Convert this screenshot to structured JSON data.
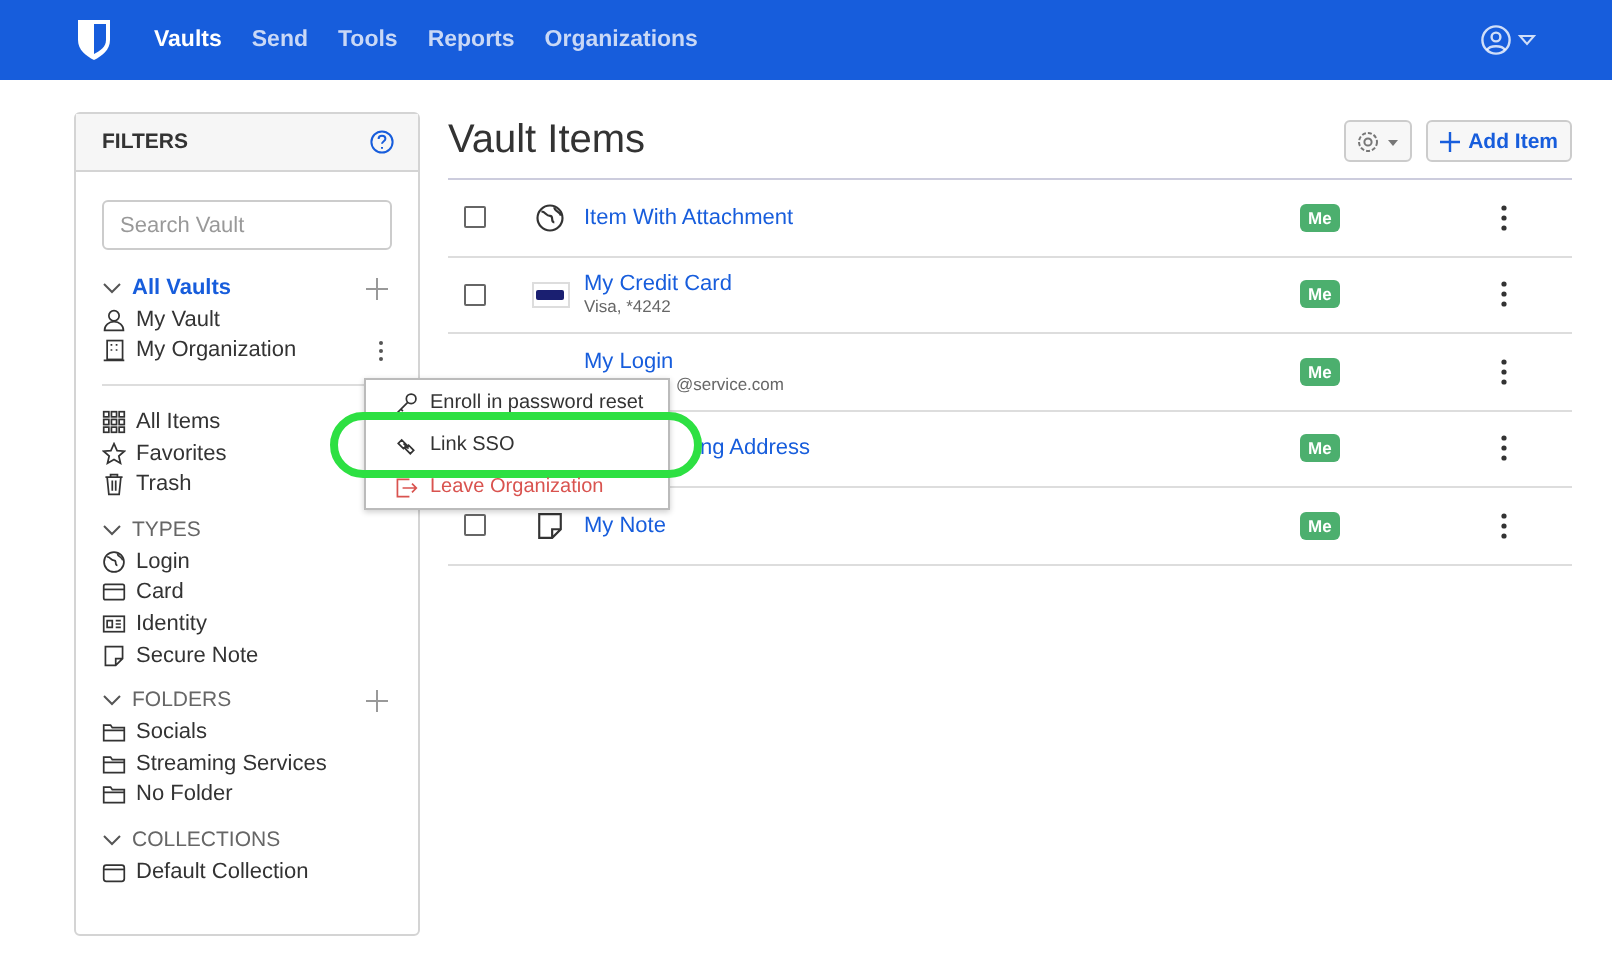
{
  "nav": {
    "links": [
      {
        "label": "Vaults",
        "selected": true
      },
      {
        "label": "Send",
        "selected": false
      },
      {
        "label": "Tools",
        "selected": false
      },
      {
        "label": "Reports",
        "selected": false
      },
      {
        "label": "Organizations",
        "selected": false
      }
    ]
  },
  "filters": {
    "title": "FILTERS",
    "search": {
      "placeholder": "Search Vault"
    },
    "sections": [
      {
        "kind": "vaults",
        "heading": "All Vaults",
        "selected": true,
        "expanded": true,
        "add": true,
        "items": [
          {
            "label": "My Vault",
            "kind": "person"
          },
          {
            "label": "My Organization",
            "kind": "org",
            "options": true
          }
        ]
      },
      {
        "divider": true,
        "items": [
          {
            "label": "All Items",
            "kind": "grid"
          },
          {
            "label": "Favorites",
            "kind": "star"
          },
          {
            "label": "Trash",
            "kind": "trash"
          }
        ]
      },
      {
        "kind": "group",
        "heading": "TYPES",
        "expanded": true,
        "items": [
          {
            "label": "Login",
            "kind": "globe"
          },
          {
            "label": "Card",
            "kind": "card"
          },
          {
            "label": "Identity",
            "kind": "id"
          },
          {
            "label": "Secure Note",
            "kind": "note"
          }
        ]
      },
      {
        "kind": "group",
        "heading": "FOLDERS",
        "expanded": true,
        "add": true,
        "items": [
          {
            "label": "Socials",
            "kind": "folder"
          },
          {
            "label": "Streaming Services",
            "kind": "folder"
          },
          {
            "label": "No Folder",
            "kind": "folder"
          }
        ]
      },
      {
        "kind": "group",
        "heading": "COLLECTIONS",
        "expanded": true,
        "items": [
          {
            "label": "Default Collection",
            "kind": "collection"
          }
        ]
      }
    ]
  },
  "main": {
    "title": "Vault Items",
    "add_button": "Add Item",
    "rows": [
      {
        "name": "Item With Attachment",
        "kind": "globe",
        "owner": "Me",
        "checked": false
      },
      {
        "name": "My Credit Card",
        "subtitle": "Visa, *4242",
        "kind": "visa",
        "owner": "Me",
        "checked": false
      },
      {
        "name": "My Login",
        "subtitle": "@service.com",
        "kind": "covered",
        "owner": "Me"
      },
      {
        "name": "ng Address",
        "kind": "covered",
        "owner": "Me"
      },
      {
        "name": "My Note",
        "kind": "note",
        "owner": "Me",
        "checked": false
      }
    ]
  },
  "menu": {
    "items": [
      {
        "label": "Enroll in password reset",
        "kind": "key",
        "highlighted": false
      },
      {
        "label": "Link SSO",
        "kind": "link",
        "highlighted": true
      },
      {
        "label": "Leave Organization",
        "kind": "danger",
        "highlighted": false
      }
    ]
  }
}
